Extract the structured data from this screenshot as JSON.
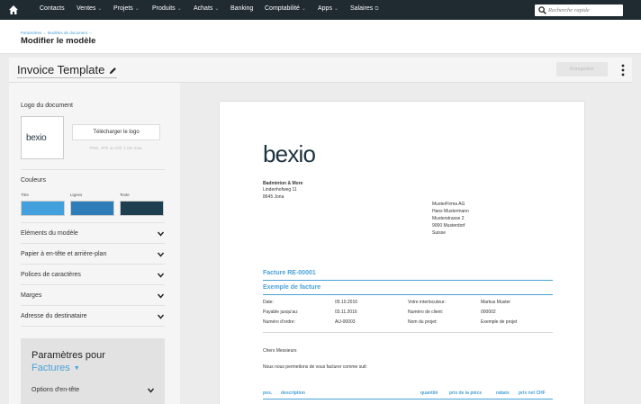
{
  "topnav": {
    "items": [
      {
        "label": "Contacts",
        "dropdown": false
      },
      {
        "label": "Ventes",
        "dropdown": true
      },
      {
        "label": "Projets",
        "dropdown": true
      },
      {
        "label": "Produits",
        "dropdown": true
      },
      {
        "label": "Achats",
        "dropdown": true
      },
      {
        "label": "Banking",
        "dropdown": false
      },
      {
        "label": "Comptabilité",
        "dropdown": true
      },
      {
        "label": "Apps",
        "dropdown": true
      },
      {
        "label": "Salaires",
        "dropdown": false,
        "external": true
      }
    ],
    "chevron": "⌄",
    "external_glyph": "⧉",
    "search_placeholder": "Recherche rapide"
  },
  "header": {
    "breadcrumb": [
      "Paramètres",
      "Modèles de document"
    ],
    "breadcrumb_sep": "»",
    "title": "Modifier le modèle"
  },
  "titlebar": {
    "template_name": "Invoice Template",
    "save_label": "Enregistrer"
  },
  "sidebar": {
    "logo_section": "Logo du document",
    "logo_text": "bexio",
    "upload_label": "Télécharger le logo",
    "upload_hint": "PNG, JPG ou GIF, 1 Mo max.",
    "colors_section": "Couleurs",
    "color_labels": [
      "Titre",
      "Lignes",
      "Texte"
    ],
    "colors": [
      "#42a1dc",
      "#2f7db8",
      "#1d3f4f"
    ],
    "accordions": [
      "Eléments du modèle",
      "Papier à en-tête et arrière-plan",
      "Polices de caractères",
      "Marges",
      "Adresse du destinataire"
    ],
    "params_title": "Paramètres pour",
    "params_doc_type": "Factures",
    "params_option": "Options d'en-tête"
  },
  "preview": {
    "logo": "bexio",
    "sender": [
      "Badminton & More",
      "Lindenhofweg 11",
      "8645 Jona"
    ],
    "recipient": [
      "MusterFirma AG",
      "Hans Mustermann",
      "Musterstrasse 2",
      "9000 Musterdorf",
      "Suisse"
    ],
    "invoice_number": "Facture RE-00001",
    "invoice_title": "Exemple de facture",
    "details_left": [
      {
        "label": "Date:",
        "value": "05.10.2016"
      },
      {
        "label": "Payable jusqu'au:",
        "value": "03.11.2016"
      },
      {
        "label": "Numéro d'ordre:",
        "value": "AU-00003"
      }
    ],
    "details_right": [
      {
        "label": "Votre interlocuteur:",
        "value": "Markus Muster"
      },
      {
        "label": "Numéro de client:",
        "value": "000002"
      },
      {
        "label": "Nom du projet:",
        "value": "Exemple de projet"
      }
    ],
    "greeting": "Chers Messieurs",
    "intro": "Nous nous permettons de vous facturer comme suit:",
    "table_headers": [
      "pos.",
      "description",
      "quantité",
      "prix de la pièce",
      "rabais",
      "prix net CHF"
    ]
  }
}
